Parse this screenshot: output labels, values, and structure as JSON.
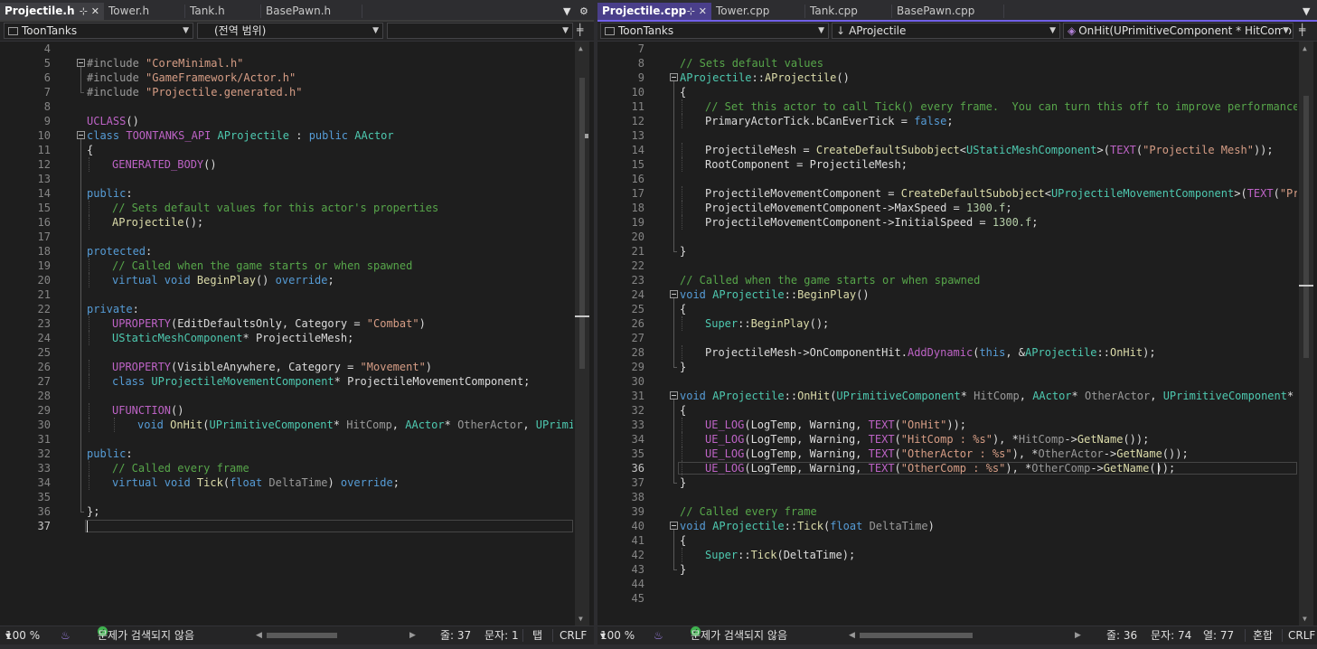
{
  "left": {
    "tabs": [
      {
        "label": "Projectile.h",
        "active": true
      },
      {
        "label": "Tower.h",
        "active": false
      },
      {
        "label": "Tank.h",
        "active": false
      },
      {
        "label": "BasePawn.h",
        "active": false
      }
    ],
    "nav": {
      "project": "ToonTanks",
      "scope": "(전역 범위)",
      "member": ""
    },
    "code": [
      {
        "n": 4,
        "segs": []
      },
      {
        "n": 5,
        "fold": true,
        "segs": [
          [
            "pp",
            "#include "
          ],
          [
            "st",
            "\"CoreMinimal.h\""
          ]
        ]
      },
      {
        "n": 6,
        "segs": [
          [
            "pp",
            "#include "
          ],
          [
            "st",
            "\"GameFramework/Actor.h\""
          ]
        ]
      },
      {
        "n": 7,
        "segs": [
          [
            "pp",
            "#include "
          ],
          [
            "st",
            "\"Projectile.generated.h\""
          ]
        ]
      },
      {
        "n": 8,
        "segs": []
      },
      {
        "n": 9,
        "segs": [
          [
            "mc",
            "UCLASS"
          ],
          [
            "",
            "()"
          ]
        ]
      },
      {
        "n": 10,
        "fold": true,
        "segs": [
          [
            "kw",
            "class "
          ],
          [
            "mc",
            "TOONTANKS_API "
          ],
          [
            "ty",
            "AProjectile"
          ],
          [
            "",
            " : "
          ],
          [
            "kw",
            "public "
          ],
          [
            "ty",
            "AActor"
          ]
        ]
      },
      {
        "n": 11,
        "segs": [
          [
            "",
            "{"
          ]
        ]
      },
      {
        "n": 12,
        "indent": 1,
        "segs": [
          [
            "mc",
            "GENERATED_BODY"
          ],
          [
            "",
            "()"
          ]
        ]
      },
      {
        "n": 13,
        "segs": []
      },
      {
        "n": 14,
        "segs": [
          [
            "kw",
            "public"
          ],
          [
            "",
            ":"
          ]
        ]
      },
      {
        "n": 15,
        "indent": 1,
        "segs": [
          [
            "cm",
            "// Sets default values for this actor's properties"
          ]
        ]
      },
      {
        "n": 16,
        "indent": 1,
        "segs": [
          [
            "fn",
            "AProjectile"
          ],
          [
            "",
            "();"
          ]
        ]
      },
      {
        "n": 17,
        "segs": []
      },
      {
        "n": 18,
        "segs": [
          [
            "kw",
            "protected"
          ],
          [
            "",
            ":"
          ]
        ]
      },
      {
        "n": 19,
        "indent": 1,
        "segs": [
          [
            "cm",
            "// Called when the game starts or when spawned"
          ]
        ]
      },
      {
        "n": 20,
        "indent": 1,
        "segs": [
          [
            "kw",
            "virtual void "
          ],
          [
            "fn",
            "BeginPlay"
          ],
          [
            "",
            "() "
          ],
          [
            "kw",
            "override"
          ],
          [
            "",
            ";"
          ]
        ]
      },
      {
        "n": 21,
        "segs": []
      },
      {
        "n": 22,
        "segs": [
          [
            "kw",
            "private"
          ],
          [
            "",
            ":"
          ]
        ]
      },
      {
        "n": 23,
        "indent": 1,
        "segs": [
          [
            "mc",
            "UPROPERTY"
          ],
          [
            "",
            "(EditDefaultsOnly, Category = "
          ],
          [
            "st",
            "\"Combat\""
          ],
          [
            "",
            ")"
          ]
        ]
      },
      {
        "n": 24,
        "indent": 1,
        "segs": [
          [
            "ty",
            "UStaticMeshComponent"
          ],
          [
            "",
            "* ProjectileMesh;"
          ]
        ]
      },
      {
        "n": 25,
        "segs": []
      },
      {
        "n": 26,
        "indent": 1,
        "segs": [
          [
            "mc",
            "UPROPERTY"
          ],
          [
            "",
            "(VisibleAnywhere, Category = "
          ],
          [
            "st",
            "\"Movement\""
          ],
          [
            "",
            ")"
          ]
        ]
      },
      {
        "n": 27,
        "indent": 1,
        "segs": [
          [
            "kw",
            "class "
          ],
          [
            "ty",
            "UProjectileMovementComponent"
          ],
          [
            "",
            "* ProjectileMovementComponent;"
          ]
        ]
      },
      {
        "n": 28,
        "segs": []
      },
      {
        "n": 29,
        "indent": 1,
        "segs": [
          [
            "mc",
            "UFUNCTION"
          ],
          [
            "",
            "()"
          ]
        ]
      },
      {
        "n": 30,
        "indent": 2,
        "segs": [
          [
            "kw",
            "void "
          ],
          [
            "fn",
            "OnHit"
          ],
          [
            "",
            "("
          ],
          [
            "ty",
            "UPrimitiveComponent"
          ],
          [
            "",
            "* "
          ],
          [
            "pa",
            "HitComp"
          ],
          [
            ", ",
            ""
          ],
          [
            "ty",
            "AActor"
          ],
          [
            "",
            "* "
          ],
          [
            "pa",
            "OtherActor"
          ],
          [
            "",
            ", "
          ],
          [
            "ty",
            "UPrimiti"
          ]
        ]
      },
      {
        "n": 31,
        "segs": []
      },
      {
        "n": 32,
        "segs": [
          [
            "kw",
            "public"
          ],
          [
            "",
            ":"
          ]
        ]
      },
      {
        "n": 33,
        "indent": 1,
        "segs": [
          [
            "cm",
            "// Called every frame"
          ]
        ]
      },
      {
        "n": 34,
        "indent": 1,
        "segs": [
          [
            "kw",
            "virtual void "
          ],
          [
            "fn",
            "Tick"
          ],
          [
            "",
            "("
          ],
          [
            "kw",
            "float "
          ],
          [
            "pa",
            "DeltaTime"
          ],
          [
            "",
            ") "
          ],
          [
            "kw",
            "override"
          ],
          [
            "",
            ";"
          ]
        ]
      },
      {
        "n": 35,
        "segs": []
      },
      {
        "n": 36,
        "segs": [
          [
            "",
            "};"
          ]
        ]
      },
      {
        "n": 37,
        "cur": true,
        "segs": []
      }
    ],
    "status": {
      "zoom": "100 %",
      "issues": "문제가 검색되지 않음",
      "line": "줄: 37",
      "col": "문자: 1",
      "indent": "탭",
      "eol": "CRLF"
    }
  },
  "right": {
    "tabs": [
      {
        "label": "Projectile.cpp",
        "active": true
      },
      {
        "label": "Tower.cpp",
        "active": false
      },
      {
        "label": "Tank.cpp",
        "active": false
      },
      {
        "label": "BasePawn.cpp",
        "active": false
      }
    ],
    "nav": {
      "project": "ToonTanks",
      "scope": "AProjectile",
      "member": "OnHit(UPrimitiveComponent * HitComp,"
    },
    "code": [
      {
        "n": 7,
        "segs": []
      },
      {
        "n": 8,
        "segs": [
          [
            "cm",
            "// Sets default values"
          ]
        ]
      },
      {
        "n": 9,
        "fold": true,
        "segs": [
          [
            "ty",
            "AProjectile"
          ],
          [
            "",
            "::"
          ],
          [
            "fn",
            "AProjectile"
          ],
          [
            "",
            "()"
          ]
        ]
      },
      {
        "n": 10,
        "segs": [
          [
            "",
            "{"
          ]
        ]
      },
      {
        "n": 11,
        "indent": 1,
        "segs": [
          [
            "cm",
            "// Set this actor to call Tick() every frame.  You can turn this off to improve performance if"
          ]
        ]
      },
      {
        "n": 12,
        "indent": 1,
        "segs": [
          [
            "",
            "PrimaryActorTick.bCanEverTick = "
          ],
          [
            "kw",
            "false"
          ],
          [
            "",
            ";"
          ]
        ]
      },
      {
        "n": 13,
        "segs": []
      },
      {
        "n": 14,
        "indent": 1,
        "segs": [
          [
            "",
            "ProjectileMesh = "
          ],
          [
            "fn",
            "CreateDefaultSubobject"
          ],
          [
            "",
            "<"
          ],
          [
            "ty",
            "UStaticMeshComponent"
          ],
          [
            "",
            ">("
          ],
          [
            "mc",
            "TEXT"
          ],
          [
            "",
            "("
          ],
          [
            "st",
            "\"Projectile Mesh\""
          ],
          [
            "",
            "));"
          ]
        ]
      },
      {
        "n": 15,
        "indent": 1,
        "segs": [
          [
            "",
            "RootComponent = ProjectileMesh;"
          ]
        ]
      },
      {
        "n": 16,
        "segs": []
      },
      {
        "n": 17,
        "indent": 1,
        "segs": [
          [
            "",
            "ProjectileMovementComponent = "
          ],
          [
            "fn",
            "CreateDefaultSubobject"
          ],
          [
            "",
            "<"
          ],
          [
            "ty",
            "UProjectileMovementComponent"
          ],
          [
            "",
            ">("
          ],
          [
            "mc",
            "TEXT"
          ],
          [
            "",
            "("
          ],
          [
            "st",
            "\"Proje"
          ]
        ]
      },
      {
        "n": 18,
        "indent": 1,
        "segs": [
          [
            "",
            "ProjectileMovementComponent->MaxSpeed = "
          ],
          [
            "nu",
            "1300.f"
          ],
          [
            "",
            ";"
          ]
        ]
      },
      {
        "n": 19,
        "indent": 1,
        "segs": [
          [
            "",
            "ProjectileMovementComponent->InitialSpeed = "
          ],
          [
            "nu",
            "1300.f"
          ],
          [
            "",
            ";"
          ]
        ]
      },
      {
        "n": 20,
        "segs": []
      },
      {
        "n": 21,
        "segs": [
          [
            "",
            "}"
          ]
        ]
      },
      {
        "n": 22,
        "segs": []
      },
      {
        "n": 23,
        "segs": [
          [
            "cm",
            "// Called when the game starts or when spawned"
          ]
        ]
      },
      {
        "n": 24,
        "fold": true,
        "segs": [
          [
            "kw",
            "void "
          ],
          [
            "ty",
            "AProjectile"
          ],
          [
            "",
            "::"
          ],
          [
            "fn",
            "BeginPlay"
          ],
          [
            "",
            "()"
          ]
        ]
      },
      {
        "n": 25,
        "segs": [
          [
            "",
            "{"
          ]
        ]
      },
      {
        "n": 26,
        "indent": 1,
        "segs": [
          [
            "ty",
            "Super"
          ],
          [
            "",
            "::"
          ],
          [
            "fn",
            "BeginPlay"
          ],
          [
            "",
            "();"
          ]
        ]
      },
      {
        "n": 27,
        "segs": []
      },
      {
        "n": 28,
        "indent": 1,
        "segs": [
          [
            "",
            "ProjectileMesh->OnComponentHit."
          ],
          [
            "mc",
            "AddDynamic"
          ],
          [
            "",
            "("
          ],
          [
            "kw",
            "this"
          ],
          [
            "",
            ", &"
          ],
          [
            "ty",
            "AProjectile"
          ],
          [
            "",
            "::"
          ],
          [
            "fn",
            "OnHit"
          ],
          [
            "",
            ");"
          ]
        ]
      },
      {
        "n": 29,
        "segs": [
          [
            "",
            "}"
          ]
        ]
      },
      {
        "n": 30,
        "segs": []
      },
      {
        "n": 31,
        "fold": true,
        "segs": [
          [
            "kw",
            "void "
          ],
          [
            "ty",
            "AProjectile"
          ],
          [
            "",
            "::"
          ],
          [
            "fn",
            "OnHit"
          ],
          [
            "",
            "("
          ],
          [
            "ty",
            "UPrimitiveComponent"
          ],
          [
            "",
            "* "
          ],
          [
            "pa",
            "HitComp"
          ],
          [
            "",
            ", "
          ],
          [
            "ty",
            "AActor"
          ],
          [
            "",
            "* "
          ],
          [
            "pa",
            "OtherActor"
          ],
          [
            "",
            ", "
          ],
          [
            "ty",
            "UPrimitiveComponent"
          ],
          [
            "",
            "* "
          ],
          [
            "pa",
            "Oth"
          ]
        ]
      },
      {
        "n": 32,
        "segs": [
          [
            "",
            "{"
          ]
        ]
      },
      {
        "n": 33,
        "indent": 1,
        "segs": [
          [
            "mc",
            "UE_LOG"
          ],
          [
            "",
            "(LogTemp, Warning, "
          ],
          [
            "mc",
            "TEXT"
          ],
          [
            "",
            "("
          ],
          [
            "st",
            "\"OnHit\""
          ],
          [
            "",
            "));"
          ]
        ]
      },
      {
        "n": 34,
        "indent": 1,
        "segs": [
          [
            "mc",
            "UE_LOG"
          ],
          [
            "",
            "(LogTemp, Warning, "
          ],
          [
            "mc",
            "TEXT"
          ],
          [
            "",
            "("
          ],
          [
            "st",
            "\"HitComp : %s\""
          ],
          [
            "",
            "), *"
          ],
          [
            "pa",
            "HitComp"
          ],
          [
            "",
            "->"
          ],
          [
            "fn",
            "GetName"
          ],
          [
            "",
            "());"
          ]
        ]
      },
      {
        "n": 35,
        "indent": 1,
        "segs": [
          [
            "mc",
            "UE_LOG"
          ],
          [
            "",
            "(LogTemp, Warning, "
          ],
          [
            "mc",
            "TEXT"
          ],
          [
            "",
            "("
          ],
          [
            "st",
            "\"OtherActor : %s\""
          ],
          [
            "",
            "), *"
          ],
          [
            "pa",
            "OtherActor"
          ],
          [
            "",
            "->"
          ],
          [
            "fn",
            "GetName"
          ],
          [
            "",
            "());"
          ]
        ]
      },
      {
        "n": 36,
        "indent": 1,
        "cur": true,
        "segs": [
          [
            "mc",
            "UE_LOG"
          ],
          [
            "",
            "(LogTemp, Warning, "
          ],
          [
            "mc",
            "TEXT"
          ],
          [
            "",
            "("
          ],
          [
            "st",
            "\"OtherComp : %s\""
          ],
          [
            "",
            "), *"
          ],
          [
            "pa",
            "OtherComp"
          ],
          [
            "",
            "->"
          ],
          [
            "fn",
            "GetName"
          ],
          [
            "",
            "());"
          ]
        ]
      },
      {
        "n": 37,
        "segs": [
          [
            "",
            "}"
          ]
        ]
      },
      {
        "n": 38,
        "segs": []
      },
      {
        "n": 39,
        "segs": [
          [
            "cm",
            "// Called every frame"
          ]
        ]
      },
      {
        "n": 40,
        "fold": true,
        "segs": [
          [
            "kw",
            "void "
          ],
          [
            "ty",
            "AProjectile"
          ],
          [
            "",
            "::"
          ],
          [
            "fn",
            "Tick"
          ],
          [
            "",
            "("
          ],
          [
            "kw",
            "float "
          ],
          [
            "pa",
            "DeltaTime"
          ],
          [
            "",
            ")"
          ]
        ]
      },
      {
        "n": 41,
        "segs": [
          [
            "",
            "{"
          ]
        ]
      },
      {
        "n": 42,
        "indent": 1,
        "segs": [
          [
            "ty",
            "Super"
          ],
          [
            "",
            "::"
          ],
          [
            "fn",
            "Tick"
          ],
          [
            "",
            "(DeltaTime);"
          ]
        ]
      },
      {
        "n": 43,
        "segs": [
          [
            "",
            "}"
          ]
        ]
      },
      {
        "n": 44,
        "segs": []
      },
      {
        "n": 45,
        "segs": []
      }
    ],
    "status": {
      "zoom": "100 %",
      "issues": "문제가 검색되지 않음",
      "line": "줄: 36",
      "col": "문자: 74",
      "column": "열: 77",
      "indent": "혼합",
      "eol": "CRLF"
    }
  }
}
